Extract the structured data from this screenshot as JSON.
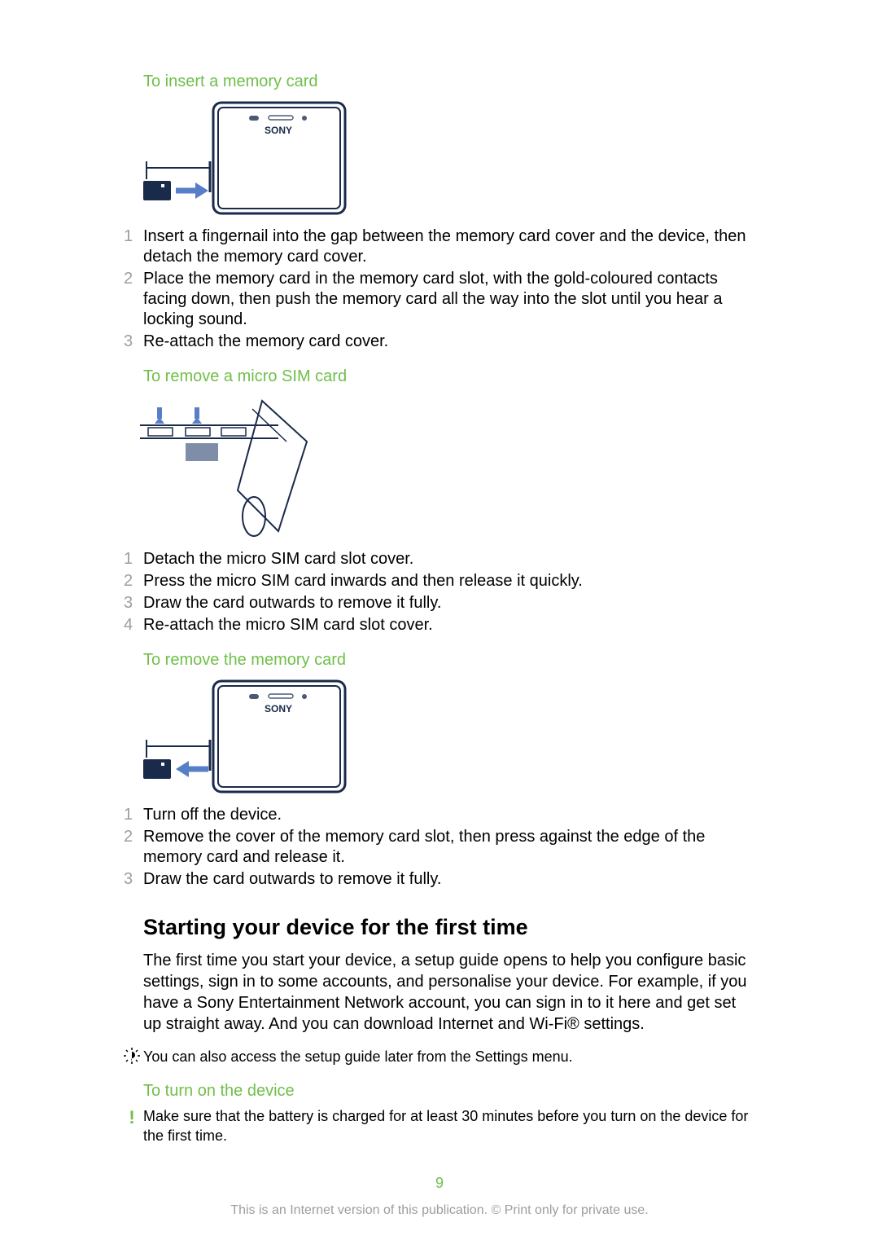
{
  "sections": {
    "insert_memory": {
      "title": "To insert a memory card",
      "steps": [
        "Insert a fingernail into the gap between the memory card cover and the device, then detach the memory card cover.",
        "Place the memory card in the memory card slot, with the gold-coloured contacts facing down, then push the memory card all the way into the slot until you hear a locking sound.",
        "Re-attach the memory card cover."
      ]
    },
    "remove_sim": {
      "title": "To remove a micro SIM card",
      "steps": [
        "Detach the micro SIM card slot cover.",
        "Press the micro SIM card inwards and then release it quickly.",
        "Draw the card outwards to remove it fully.",
        "Re-attach the micro SIM card slot cover."
      ]
    },
    "remove_memory": {
      "title": "To remove the memory card",
      "steps": [
        "Turn off the device.",
        "Remove the cover of the memory card slot, then press against the edge of the memory card and release it.",
        "Draw the card outwards to remove it fully."
      ]
    },
    "starting": {
      "heading": "Starting your device for the first time",
      "body": "The first time you start your device, a setup guide opens to help you configure basic settings, sign in to some accounts, and personalise your device. For example, if you have a Sony Entertainment Network account, you can sign in to it here and get set up straight away. And you can download Internet and Wi-Fi® settings.",
      "tip": "You can also access the setup guide later from the Settings menu."
    },
    "turn_on": {
      "title": "To turn on the device",
      "warning": "Make sure that the battery is charged for at least 30 minutes before you turn on the device for the first time."
    }
  },
  "illus_label": "SONY",
  "page_number": "9",
  "footer": "This is an Internet version of this publication. © Print only for private use."
}
